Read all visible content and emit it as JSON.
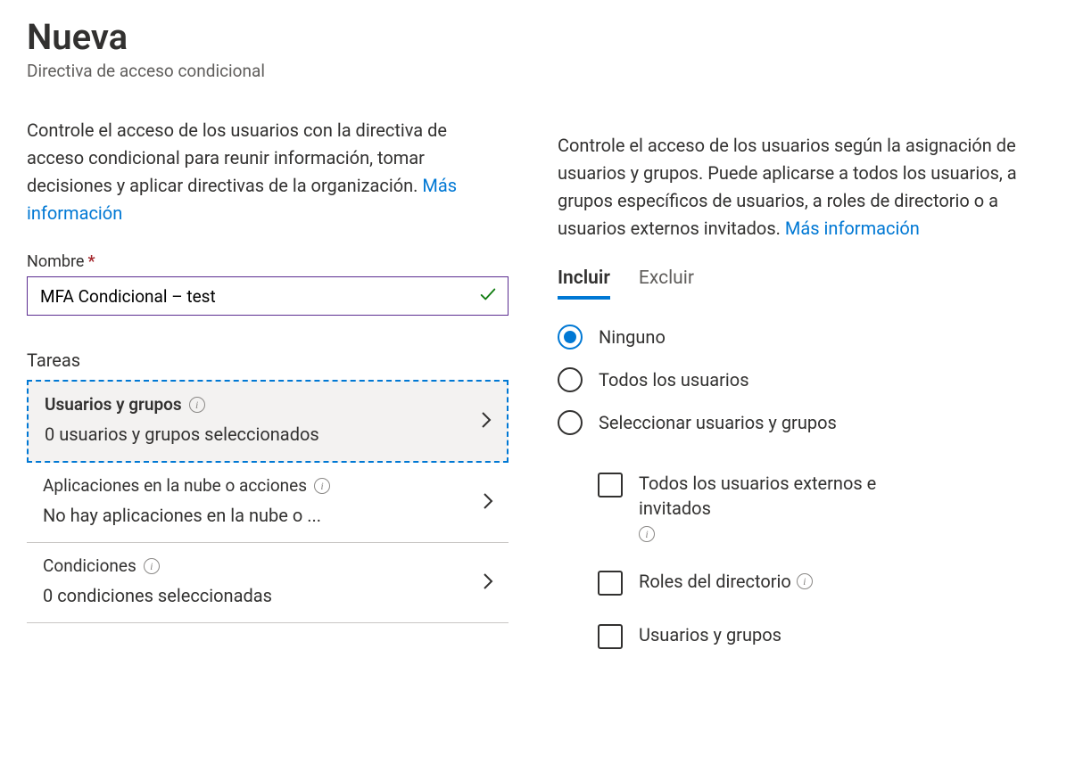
{
  "header": {
    "title": "Nueva",
    "subtitle": "Directiva de acceso condicional"
  },
  "left": {
    "description": "Controle el acceso de los usuarios con la directiva de acceso condicional para reunir información, tomar decisiones y aplicar directivas de la organización.",
    "more_link": "Más información",
    "name_label": "Nombre",
    "name_value": "MFA Condicional – test",
    "tasks_heading": "Tareas",
    "tasks": [
      {
        "title": "Usuarios y grupos",
        "status": "0 usuarios y grupos seleccionados",
        "info": true,
        "selected": true
      },
      {
        "title": "Aplicaciones en la nube o acciones",
        "status": "No hay aplicaciones en la nube o ...",
        "info": true,
        "selected": false
      },
      {
        "title": "Condiciones",
        "status": "0 condiciones seleccionadas",
        "info": true,
        "selected": false
      }
    ]
  },
  "right": {
    "description": "Controle el acceso de los usuarios según la asignación de usuarios y grupos. Puede aplicarse a todos los usuarios, a grupos específicos de usuarios, a roles de directorio o a usuarios externos invitados.",
    "more_link": "Más información",
    "tabs": {
      "include": "Incluir",
      "exclude": "Excluir"
    },
    "radios": {
      "none": "Ninguno",
      "all": "Todos los usuarios",
      "select": "Seleccionar usuarios y grupos"
    },
    "checkboxes": {
      "guests": "Todos los usuarios externos e invitados",
      "roles": "Roles del directorio",
      "users_groups": "Usuarios y grupos"
    }
  }
}
